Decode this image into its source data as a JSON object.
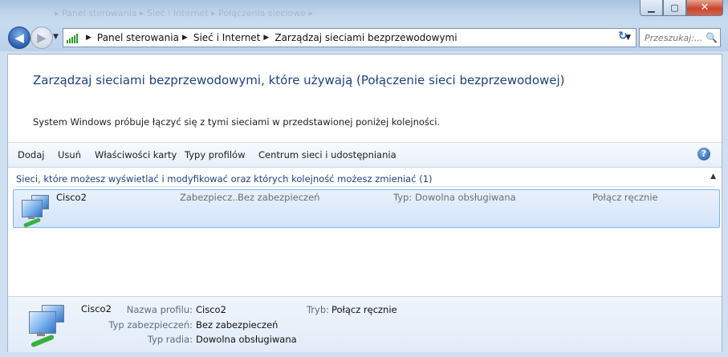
{
  "window": {
    "ghost_breadcrumb": "▸ Panel sterowania ▸ Sieć i Internet ▸ Połączenia sieciowe ▸",
    "controls": {
      "minimize": "▁",
      "maximize": "▢",
      "close": "✕"
    }
  },
  "navigation": {
    "back": "◀",
    "forward": "▶",
    "history_dropdown": "▼",
    "breadcrumbs": [
      "Panel sterowania",
      "Sieć i Internet",
      "Zarządzaj sieciami bezprzewodowymi"
    ],
    "breadcrumb_separator": "▶",
    "address_dropdown": "▼",
    "refresh": "↻",
    "search_placeholder": "Przeszukaj:...",
    "search_icon": "🔍"
  },
  "page": {
    "heading": "Zarządzaj sieciami bezprzewodowymi, które używają (Połączenie sieci bezprzewodowej)",
    "description": "System Windows próbuje łączyć się z tymi sieciami w przedstawionej poniżej kolejności."
  },
  "toolbar": {
    "items": [
      "Dodaj",
      "Usuń",
      "Właściwości karty",
      "Typy profilów",
      "Centrum sieci i udostępniania"
    ],
    "help": "?"
  },
  "group": {
    "header": "Sieci, które możesz wyświetlać i modyfikować oraz których kolejność możesz zmieniać (1)",
    "collapse": "▲"
  },
  "networks": [
    {
      "name": "Cisco2",
      "security_label": "Zabezpiecz...",
      "security_value": "Bez zabezpieczeń",
      "type_label": "Typ:",
      "type_value": "Dowolna obsługiwana",
      "mode": "Połącz ręcznie"
    }
  ],
  "details": {
    "name": "Cisco2",
    "profile_label": "Nazwa profilu:",
    "profile_value": "Cisco2",
    "mode_label": "Tryb:",
    "mode_value": "Połącz ręcznie",
    "security_label": "Typ zabezpieczeń:",
    "security_value": "Bez zabezpieczeń",
    "radio_label": "Typ radia:",
    "radio_value": "Dowolna obsługiwana"
  },
  "colors": {
    "accent": "#1e3f86",
    "selection": "#d3e4f8",
    "selection_border": "#7eb4ea"
  }
}
